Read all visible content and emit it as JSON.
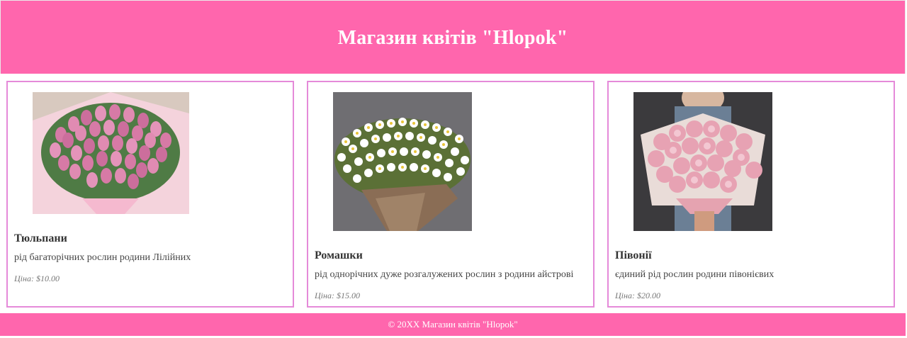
{
  "header": {
    "title": "Магазин квітів \"Hlopok\""
  },
  "products": [
    {
      "name": "Тюльпани",
      "description": "рід багаторічних рослин родини Лілійних",
      "price": "Ціна: $10.00",
      "image": "tulips-bouquet-photo"
    },
    {
      "name": "Ромашки",
      "description": "рід однорічних дуже розгалужених рослин з родини айстрові",
      "price": "Ціна: $15.00",
      "image": "chamomile-bouquet-photo"
    },
    {
      "name": "Півонії",
      "description": "єдиний рід рослин родини півонієвих",
      "price": "Ціна: $20.00",
      "image": "peonies-bouquet-photo"
    }
  ],
  "footer": {
    "copyright": "© 20XX Магазин квітів \"Hlopok\""
  },
  "colors": {
    "brand_pink": "#ff66ad",
    "card_border": "#e58ad9"
  }
}
